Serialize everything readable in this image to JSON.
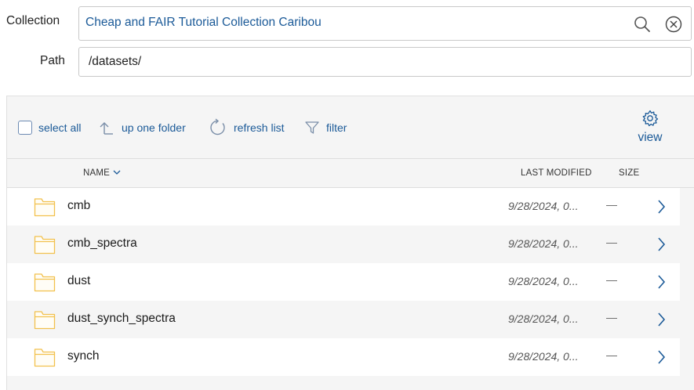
{
  "collection": {
    "label": "Collection",
    "value": "Cheap and FAIR Tutorial Collection Caribou"
  },
  "path": {
    "label": "Path",
    "value": "/datasets/"
  },
  "toolbar": {
    "select_all": "select all",
    "up_one_folder": "up one folder",
    "refresh_list": "refresh list",
    "filter": "filter",
    "view": "view"
  },
  "columns": {
    "name": "NAME",
    "last_modified": "LAST MODIFIED",
    "size": "SIZE"
  },
  "items": [
    {
      "name": "cmb",
      "modified": "9/28/2024, 0...",
      "size": "—"
    },
    {
      "name": "cmb_spectra",
      "modified": "9/28/2024, 0...",
      "size": "—"
    },
    {
      "name": "dust",
      "modified": "9/28/2024, 0...",
      "size": "—"
    },
    {
      "name": "dust_synch_spectra",
      "modified": "9/28/2024, 0...",
      "size": "—"
    },
    {
      "name": "synch",
      "modified": "9/28/2024, 0...",
      "size": "—"
    }
  ],
  "colors": {
    "accent": "#1b5a98",
    "folder": "#f2c14e",
    "panel_bg": "#f5f5f5"
  },
  "icons": [
    "search-icon",
    "clear-icon",
    "up-folder-icon",
    "refresh-icon",
    "filter-icon",
    "gear-icon",
    "sort-chevron-down-icon",
    "folder-icon",
    "chevron-right-icon"
  ]
}
